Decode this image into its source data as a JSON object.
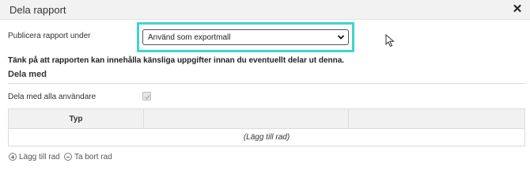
{
  "dialog": {
    "title": "Dela rapport",
    "close_icon": "close-icon",
    "close_glyph": "✕"
  },
  "publish": {
    "label": "Publicera rapport under",
    "selected_value": "Använd som exportmall",
    "highlight_color": "#3fd4cc"
  },
  "warning": "Tänk på att rapporten kan innehålla känsliga uppgifter innan du eventuellt delar ut denna.",
  "share_section": {
    "heading": "Dela med",
    "share_all_label": "Dela med alla användare",
    "share_all_checked": true
  },
  "table": {
    "columns": [
      "Typ",
      "",
      ""
    ],
    "empty_row_text": "(Lägg till rad)"
  },
  "actions": {
    "add_row_label": "Lägg till rad",
    "remove_row_label": "Ta bort rad",
    "add_icon": "plus-circle-icon",
    "remove_icon": "minus-circle-icon"
  }
}
